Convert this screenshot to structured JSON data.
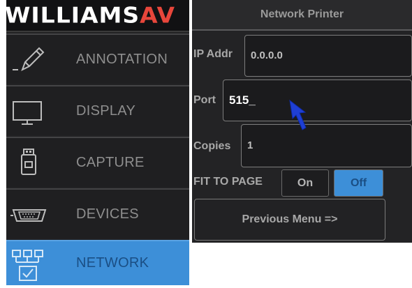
{
  "logo": {
    "main": "WILLIAMS",
    "accent": "AV"
  },
  "nav": {
    "items": [
      {
        "label": "ANNOTATION",
        "icon": "pencil-icon",
        "active": false
      },
      {
        "label": "DISPLAY",
        "icon": "monitor-icon",
        "active": false
      },
      {
        "label": "CAPTURE",
        "icon": "usb-drive-icon",
        "active": false
      },
      {
        "label": "DEVICES",
        "icon": "serial-port-icon",
        "active": false
      },
      {
        "label": "NETWORK",
        "icon": "network-icon",
        "active": true
      }
    ]
  },
  "panel": {
    "title": "Network Printer",
    "ip": {
      "label": "IP Addr",
      "value": "0.0.0.0"
    },
    "port": {
      "label": "Port",
      "value": "515_"
    },
    "copies": {
      "label": "Copies",
      "value": "1"
    },
    "fit": {
      "label": "FIT TO PAGE",
      "on_label": "On",
      "off_label": "Off",
      "selected": "Off"
    },
    "prev_label": "Previous Menu =>"
  },
  "colors": {
    "accent_blue": "#3d8fd8",
    "logo_red": "#e8463b",
    "panel_dark": "#232325"
  }
}
